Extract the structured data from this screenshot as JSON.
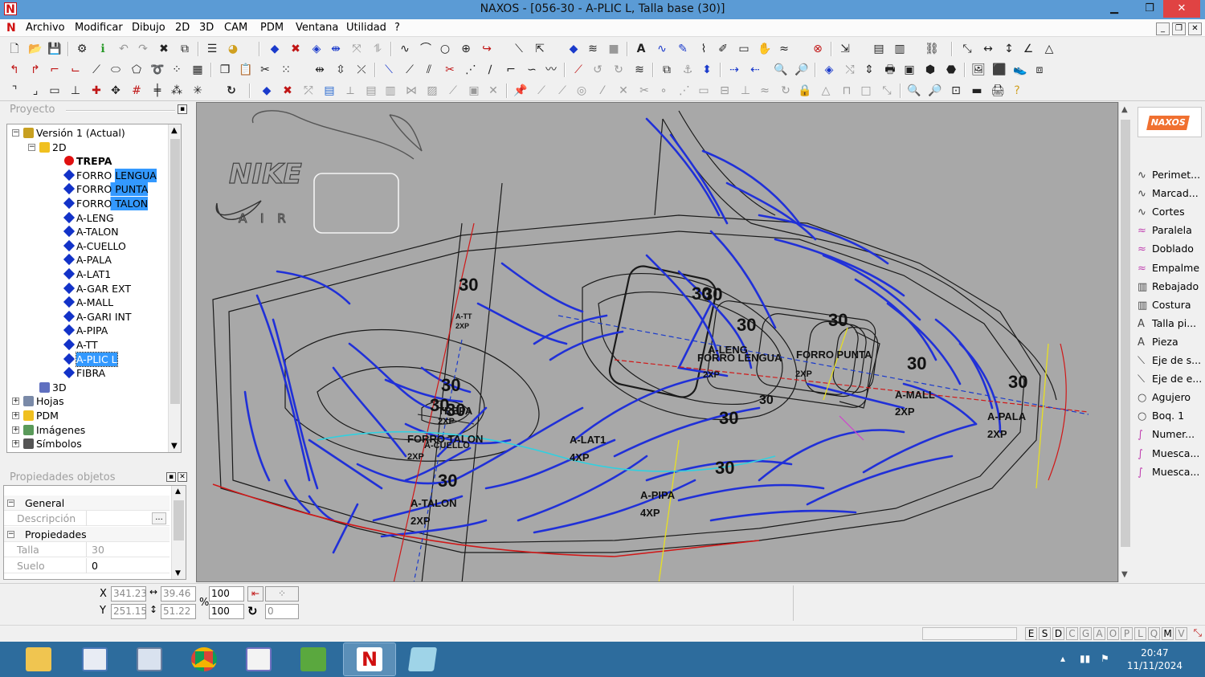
{
  "window": {
    "title": "NAXOS - [056-30 - A-PLIC L, Talla base (30)]",
    "app_icon": "naxos-logo-icon",
    "minimize": "▁",
    "maximize": "❐",
    "close": "✕"
  },
  "menu": {
    "items": [
      "Archivo",
      "Modificar",
      "Dibujo",
      "2D",
      "3D",
      "CAM",
      "PDM",
      "Ventana",
      "Utilidad",
      "?"
    ],
    "mdi": [
      "_",
      "❐",
      "✕"
    ]
  },
  "project_panel": {
    "title": "Proyecto",
    "tree": [
      {
        "label": "Versión 1 (Actual)",
        "level": 0,
        "icon": "version-icon",
        "expander": "−"
      },
      {
        "label": "2D",
        "level": 1,
        "icon": "folder-2d-icon",
        "expander": "−"
      },
      {
        "label": "TREPA",
        "level": 2,
        "icon": "red-dot-icon",
        "bold": true
      },
      {
        "label": "FORRO LENGUA",
        "level": 2,
        "icon": "piece-diamond-icon",
        "sel_part": "LENGUA"
      },
      {
        "label": "FORRO PUNTA",
        "level": 2,
        "icon": "piece-diamond-icon",
        "sel_part": "PUNTA"
      },
      {
        "label": "FORRO TALON",
        "level": 2,
        "icon": "piece-diamond-icon",
        "sel_part": "TALON"
      },
      {
        "label": "A-LENG",
        "level": 2,
        "icon": "piece-diamond-icon"
      },
      {
        "label": "A-TALON",
        "level": 2,
        "icon": "piece-diamond-icon"
      },
      {
        "label": "A-CUELLO",
        "level": 2,
        "icon": "piece-diamond-icon"
      },
      {
        "label": "A-PALA",
        "level": 2,
        "icon": "piece-diamond-icon"
      },
      {
        "label": "A-LAT1",
        "level": 2,
        "icon": "piece-diamond-icon"
      },
      {
        "label": "A-GAR EXT",
        "level": 2,
        "icon": "piece-diamond-icon"
      },
      {
        "label": "A-MALL",
        "level": 2,
        "icon": "piece-diamond-icon"
      },
      {
        "label": "A-GARI INT",
        "level": 2,
        "icon": "piece-diamond-icon"
      },
      {
        "label": "A-PIPA",
        "level": 2,
        "icon": "piece-diamond-icon"
      },
      {
        "label": "A-TT",
        "level": 2,
        "icon": "piece-diamond-icon"
      },
      {
        "label": "A-PLIC L",
        "level": 2,
        "icon": "piece-diamond-icon",
        "selected": true
      },
      {
        "label": "FIBRA",
        "level": 2,
        "icon": "piece-diamond-icon"
      },
      {
        "label": "3D",
        "level": 1,
        "icon": "shoe-3d-icon"
      },
      {
        "label": "Hojas",
        "level": 0,
        "icon": "sheets-icon",
        "expander": "+"
      },
      {
        "label": "PDM",
        "level": 0,
        "icon": "folder-icon",
        "expander": "+"
      },
      {
        "label": "Imágenes",
        "level": 0,
        "icon": "images-icon",
        "expander": "+"
      },
      {
        "label": "Símbolos",
        "level": 0,
        "icon": "symbols-icon",
        "expander": "+"
      }
    ]
  },
  "properties_panel": {
    "title": "Propiedades objetos",
    "groups": [
      {
        "name": "General",
        "rows": [
          {
            "key": "Descripción",
            "value": "",
            "button": "..."
          }
        ]
      },
      {
        "name": "Propiedades",
        "rows": [
          {
            "key": "Talla",
            "value": "30"
          },
          {
            "key": "Suelo",
            "value": "0"
          }
        ]
      }
    ]
  },
  "palette": {
    "items": [
      {
        "label": "Perimet...",
        "icon": "perimeter-icon"
      },
      {
        "label": "Marcad...",
        "icon": "marker-icon"
      },
      {
        "label": "Cortes",
        "icon": "cuts-icon"
      },
      {
        "label": "Paralela",
        "icon": "parallel-icon"
      },
      {
        "label": "Doblado",
        "icon": "fold-icon"
      },
      {
        "label": "Empalme",
        "icon": "joint-icon"
      },
      {
        "label": "Rebajado",
        "icon": "skive-icon"
      },
      {
        "label": "Costura",
        "icon": "stitch-icon"
      },
      {
        "label": "Talla pi...",
        "icon": "size-text-icon"
      },
      {
        "label": "Pieza",
        "icon": "piece-text-icon"
      },
      {
        "label": "Eje de s...",
        "icon": "axis-icon"
      },
      {
        "label": "Eje de e...",
        "icon": "axis2-icon"
      },
      {
        "label": "Agujero",
        "icon": "hole-icon"
      },
      {
        "label": "Boq. 1",
        "icon": "punch-icon"
      },
      {
        "label": "Numer...",
        "icon": "number-icon"
      },
      {
        "label": "Muesca...",
        "icon": "notch-icon"
      },
      {
        "label": "Muesca...",
        "icon": "notch2-icon"
      }
    ]
  },
  "canvas": {
    "logo_text": "NIKE",
    "logo_sub": "A I R",
    "size_labels": [
      "30",
      "30",
      "30",
      "30",
      "30",
      "30",
      "30",
      "30",
      "30",
      "30",
      "30",
      "30",
      "30",
      "30"
    ],
    "piece_labels": [
      {
        "text": "A-LENG"
      },
      {
        "text": "FORRO LENGUA"
      },
      {
        "text": "FORRO PUNTA"
      },
      {
        "text": "2XP"
      },
      {
        "text": "2XP"
      },
      {
        "text": "A-MALL"
      },
      {
        "text": "2XP"
      },
      {
        "text": "A-PALA"
      },
      {
        "text": "2XP"
      },
      {
        "text": "FORRO TALON"
      },
      {
        "text": "A-CUELLO"
      },
      {
        "text": "2XP"
      },
      {
        "text": "A-LAT1"
      },
      {
        "text": "4XP"
      },
      {
        "text": "A-TALON"
      },
      {
        "text": "2XP"
      },
      {
        "text": "A-PIPA"
      },
      {
        "text": "4XP"
      },
      {
        "text": "A-TT"
      },
      {
        "text": "2XP"
      },
      {
        "text": "TREPA"
      },
      {
        "text": "2XP"
      }
    ],
    "colors": {
      "background": "#a8a8a8",
      "outline": "#1a1a1a",
      "piece": "#2030d8",
      "axis": "#d01818",
      "accent_yellow": "#e8e020",
      "accent_cyan": "#30d0e0",
      "accent_magenta": "#d040d0"
    }
  },
  "coords": {
    "x_label": "X",
    "y_label": "Y",
    "x": "341.23",
    "y": "251.15",
    "w": "39.46",
    "h": "51.22",
    "pct_label": "%",
    "scale_x": "100",
    "scale_y": "100",
    "rotation": "0"
  },
  "statusbar": {
    "letters": [
      "E",
      "S",
      "D",
      "C",
      "G",
      "A",
      "O",
      "P",
      "L",
      "Q",
      "M",
      "V"
    ],
    "active_letters": [
      "E",
      "S",
      "D",
      "M"
    ]
  },
  "taskbar": {
    "apps": [
      "file-explorer-icon",
      "calculator-icon",
      "document-icon",
      "chrome-icon",
      "paint-icon",
      "vector-app-icon",
      "naxos-icon",
      "notes-icon"
    ],
    "time": "20:47",
    "date": "11/11/2024"
  }
}
